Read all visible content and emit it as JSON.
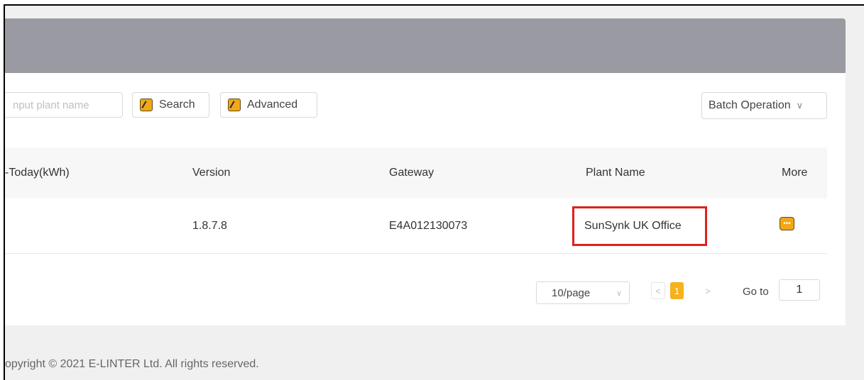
{
  "toolbar": {
    "search_placeholder": "nput plant name",
    "search_label": "Search",
    "advanced_label": "Advanced",
    "batch_label": "Batch Operation",
    "batch_chevron": "∨"
  },
  "table": {
    "columns": [
      "-Today(kWh)",
      "Version",
      "Gateway",
      "Plant Name",
      "More"
    ],
    "rows": [
      {
        "today_kwh": "",
        "version": "1.8.7.8",
        "gateway": "E4A012130073",
        "plant_name": "SunSynk UK Office"
      }
    ]
  },
  "pagination": {
    "page_size": "10/page",
    "prev": "<",
    "current_page": "1",
    "next": ">",
    "goto_label": "Go to",
    "goto_value": "1"
  },
  "footer": {
    "copyright": "opyright © 2021 E-LINTER Ltd. All rights reserved."
  },
  "colors": {
    "header_band": "#9a9aa3",
    "accent": "#f5b21a",
    "highlight_box": "#e02020"
  },
  "icons": [
    "key-icon",
    "chevron-down-icon",
    "more-dots-icon",
    "chevron-left-icon",
    "chevron-right-icon"
  ]
}
